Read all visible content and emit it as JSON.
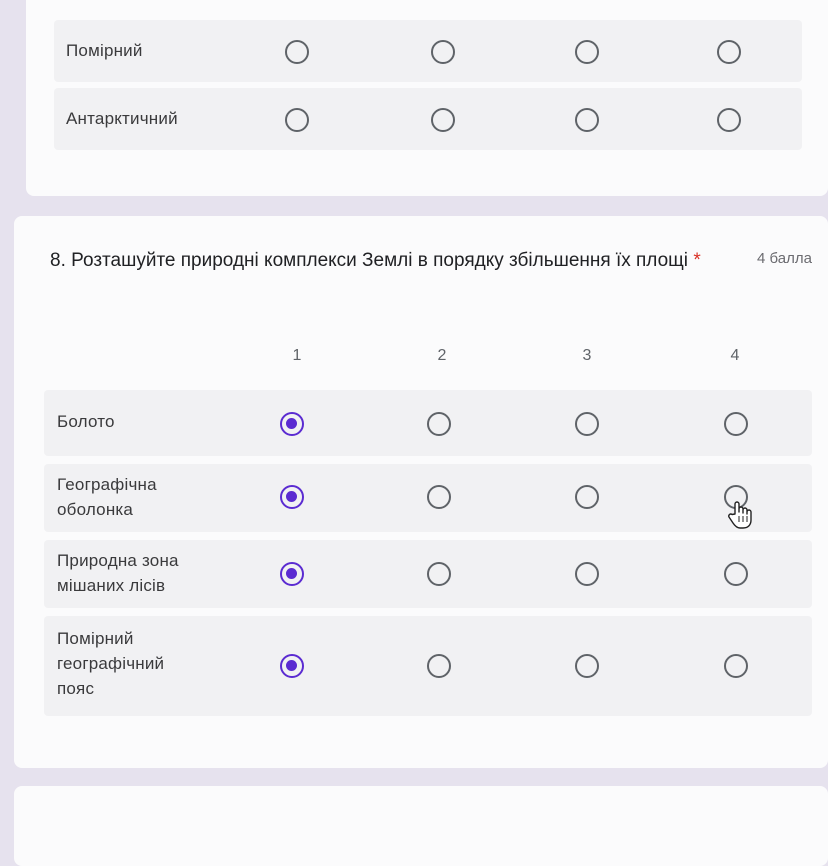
{
  "previous_question": {
    "rows": [
      {
        "label": "Помірний",
        "selected": null
      },
      {
        "label": "Антарктичний",
        "selected": null
      }
    ]
  },
  "question": {
    "number_title": "8. Розташуйте природні комплекси Землі в порядку збільшення їх площі",
    "required_mark": "*",
    "points": "4 балла",
    "columns": [
      "1",
      "2",
      "3",
      "4"
    ],
    "rows": [
      {
        "label": "Болото",
        "selected": 1
      },
      {
        "label": "Географічна оболонка",
        "selected": 1
      },
      {
        "label": "Природна зона мішаних лісів",
        "selected": 1
      },
      {
        "label": "Помірний географічний пояс",
        "selected": 1
      }
    ]
  },
  "colors": {
    "accent": "#5b2bd1",
    "background": "#e6e2ee",
    "card": "#fbfbfc",
    "row_stripe": "#f1f1f3"
  },
  "icons": {
    "cursor": "hand-pointer-icon"
  }
}
